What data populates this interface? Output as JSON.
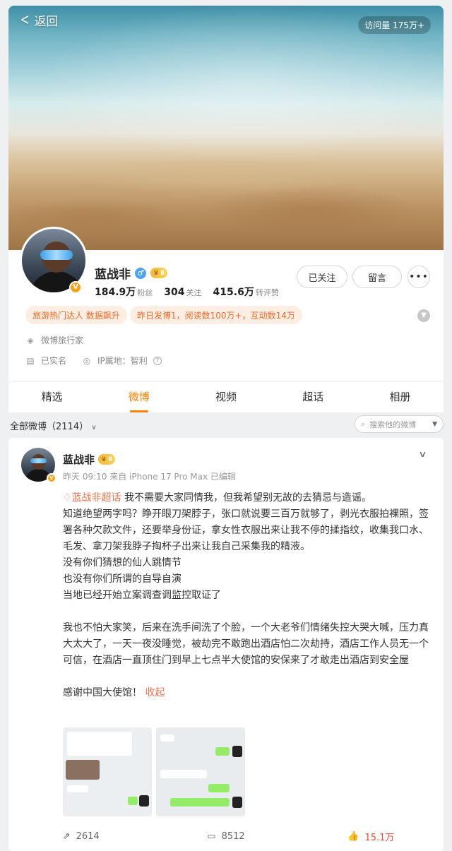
{
  "header": {
    "back_label": "返回",
    "visits": "访问量 175万+"
  },
  "profile": {
    "name": "蓝战非",
    "gender_icon": "male-icon",
    "level": "Ⅱ",
    "verified_badge": "V",
    "stats": [
      {
        "value": "184.9万",
        "label": "粉丝"
      },
      {
        "value": "304",
        "label": "关注"
      },
      {
        "value": "415.6万",
        "label": "转评赞"
      }
    ],
    "buttons": {
      "follow": "已关注",
      "message": "留言",
      "more": "•••"
    },
    "tags": [
      "旅游热门达人 数据飙升",
      "昨日发博1，阅读数100万+，互动数14万"
    ],
    "info": {
      "cert": "微博旅行家",
      "realname": "已实名",
      "ip": "IP属地：智利"
    }
  },
  "tabs": [
    {
      "label": "精选",
      "active": false
    },
    {
      "label": "微博",
      "active": true
    },
    {
      "label": "视频",
      "active": false
    },
    {
      "label": "超话",
      "active": false
    },
    {
      "label": "相册",
      "active": false
    }
  ],
  "filter": {
    "all": "全部微博（2114）",
    "search_placeholder": "搜索他的微博"
  },
  "post": {
    "name": "蓝战非",
    "level": "Ⅱ",
    "meta": "昨天 09:10 来自 iPhone 17 Pro Max 已编辑",
    "topic": "蓝战非超话",
    "text_body": " 我不需要大家同情我，但我希望别无故的去猜忌与造谣。\n知道绝望两字吗？睁开眼刀架脖子，张口就说要三百万就够了，剥光衣服拍裸照，签署各种欠款文件，还要举身份证，拿女性衣服出来让我不停的揉指纹，收集我口水、毛发、拿刀架我脖子掏杯子出来让我自己采集我的精液。\n没有你们猜想的仙人跳情节\n也没有你们所谓的自导自演\n当地已经开始立案调查调监控取证了\n\n我也不怕大家笑，后来在洗手间洗了个脸，一个大老爷们情绪失控大哭大喊，压力真大太大了，一天一夜没睡觉，被劫完不敢跑出酒店怕二次劫持，酒店工作人员无一个可信，在酒店一直顶住门到早上七点半大使馆的安保来了才敢走出酒店到安全屋\n\n感谢中国大使馆！ ",
    "collapse_label": "收起",
    "repost_count": "2614",
    "comment_count": "8512",
    "like_count": "15.1万"
  },
  "colors": {
    "accent": "#ff8200",
    "tag_text": "#f26a2b",
    "topic": "#eb7350"
  }
}
